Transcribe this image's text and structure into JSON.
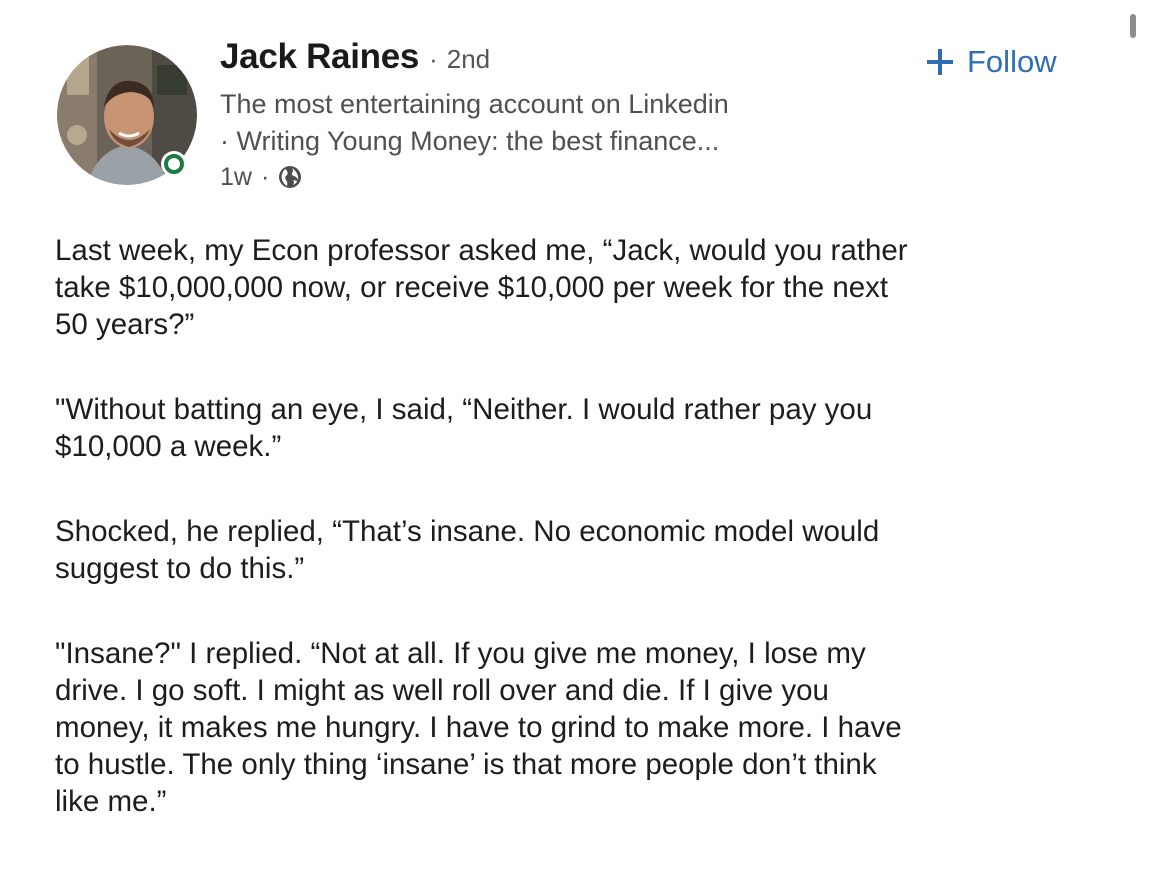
{
  "author": {
    "name": "Jack Raines",
    "degree_separator": "·",
    "degree": "2nd",
    "headline_lines": [
      "The most entertaining account on Linkedin",
      "· Writing Young Money: the best finance..."
    ],
    "time": "1w",
    "meta_separator": "·",
    "visibility_icon": "globe-icon"
  },
  "actions": {
    "follow_icon": "plus-icon",
    "follow_label": "Follow"
  },
  "post": {
    "paragraphs": [
      {
        "lines": [
          "Last week, my Econ professor asked me, “Jack, would you rather",
          "take $10,000,000 now, or receive $10,000 per week for the next",
          "50 years?”"
        ]
      },
      {
        "lines": [
          "\"Without batting an eye, I said, “Neither. I would rather pay you",
          "$10,000 a week.”"
        ]
      },
      {
        "lines": [
          "Shocked, he replied, “That’s insane. No economic model would",
          "suggest to do this.”"
        ]
      },
      {
        "lines": [
          "\"Insane?\" I replied. “Not at all. If you give me money, I lose my",
          "drive. I go soft. I might as well roll over and die. If I give you",
          "money, it makes me hungry. I have to grind to make more. I have",
          "to hustle. The only thing ‘insane’ is that more people don’t think",
          "like me.”"
        ]
      }
    ]
  },
  "colors": {
    "follow_blue": "#2d6eb4",
    "online_green": "#1d7a43",
    "secondary_text": "#505050",
    "body_text": "#1d1d1d"
  }
}
